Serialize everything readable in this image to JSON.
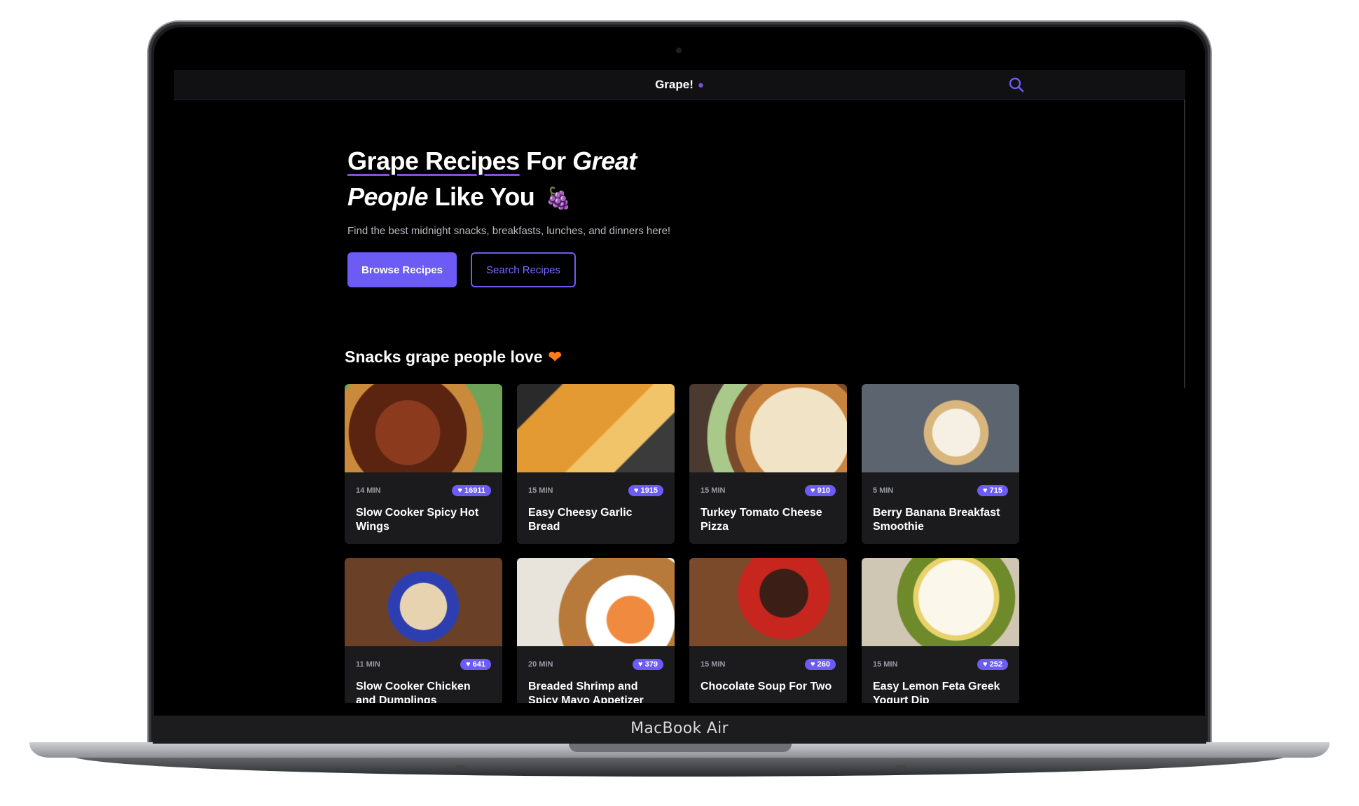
{
  "device_label": "MacBook Air",
  "nav": {
    "brand": "Grape!",
    "brand_icon": "grape-icon",
    "search_icon": "search-icon"
  },
  "hero": {
    "title_link": "Grape Recipes",
    "title_for": "For",
    "title_great": "Great",
    "title_people": "People",
    "title_like_you": "Like You",
    "title_emoji": "🍇",
    "subtitle": "Find the best midnight snacks, breakfasts, lunches, and dinners here!",
    "browse_label": "Browse Recipes",
    "search_label": "Search Recipes"
  },
  "section": {
    "title": "Snacks grape people love",
    "icon": "heart-icon",
    "heart": "❤"
  },
  "recipes": [
    {
      "time": "14 MIN",
      "likes": "16911",
      "title": "Slow Cooker Spicy Hot Wings"
    },
    {
      "time": "15 MIN",
      "likes": "1915",
      "title": "Easy Cheesy Garlic Bread"
    },
    {
      "time": "15 MIN",
      "likes": "910",
      "title": "Turkey Tomato Cheese Pizza"
    },
    {
      "time": "5 MIN",
      "likes": "715",
      "title": "Berry Banana Breakfast Smoothie"
    },
    {
      "time": "11 MIN",
      "likes": "641",
      "title": "Slow Cooker Chicken and Dumplings"
    },
    {
      "time": "20 MIN",
      "likes": "379",
      "title": "Breaded Shrimp and Spicy Mayo Appetizer"
    },
    {
      "time": "15 MIN",
      "likes": "260",
      "title": "Chocolate Soup For Two"
    },
    {
      "time": "15 MIN",
      "likes": "252",
      "title": "Easy Lemon Feta Greek Yogurt Dip"
    }
  ],
  "colors": {
    "accent": "#6c5cf5",
    "underline": "#8c4bdc",
    "heart": "#ff7a1a"
  }
}
